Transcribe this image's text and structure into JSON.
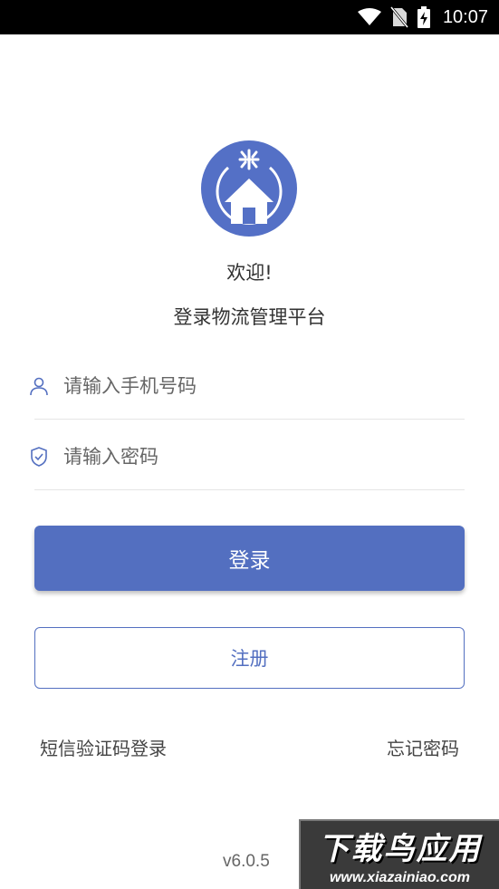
{
  "status_bar": {
    "time": "10:07",
    "icons": [
      "wifi-icon",
      "no-sim-icon",
      "battery-charging-icon"
    ]
  },
  "logo": {
    "icon": "house-logo-icon",
    "color": "#5470C6"
  },
  "welcome_text": "欢迎!",
  "subtitle": "登录物流管理平台",
  "form": {
    "phone_placeholder": "请输入手机号码",
    "phone_icon": "user-icon",
    "password_placeholder": "请输入密码",
    "password_icon": "shield-icon"
  },
  "buttons": {
    "login_label": "登录",
    "register_label": "注册",
    "accent_color": "#536FC0"
  },
  "links": {
    "sms_login": "短信验证码登录",
    "forgot_password": "忘记密码"
  },
  "version": "v6.0.5",
  "watermark": {
    "title": "下载鸟应用",
    "url": "www.xiazainiao.com"
  }
}
